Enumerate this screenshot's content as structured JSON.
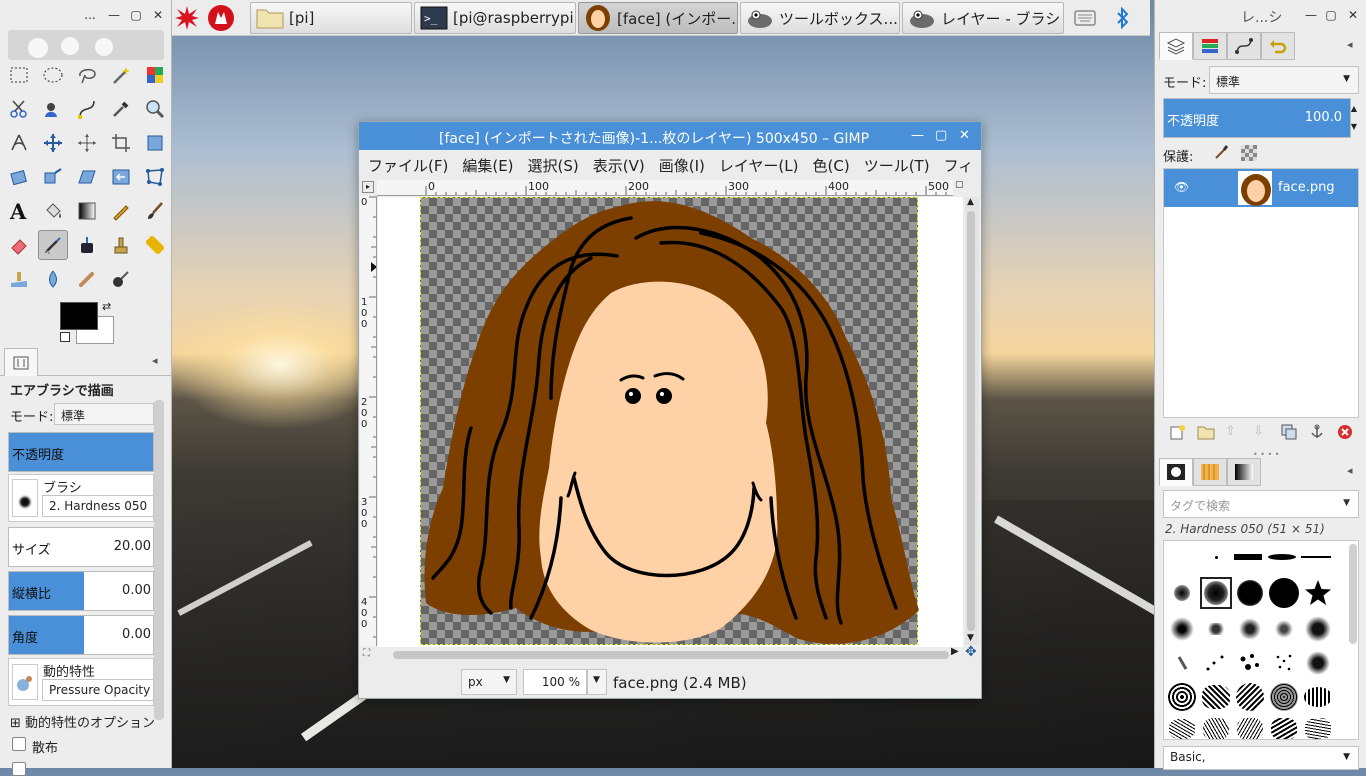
{
  "taskbar": {
    "tasks": [
      {
        "label": "[pi]",
        "icon": "folder-icon"
      },
      {
        "label": "[pi@raspberrypi:...",
        "icon": "terminal-icon"
      },
      {
        "label": "[face] (インポー...",
        "icon": "face-thumbnail-icon"
      },
      {
        "label": "ツールボックス...",
        "icon": "gimp-icon"
      },
      {
        "label": "レイヤー - ブラシ",
        "icon": "gimp-icon"
      }
    ]
  },
  "toolbox": {
    "title_dots": "...",
    "options_title": "エアブラシで描画",
    "mode_label": "モード:",
    "mode_value": "標準",
    "opacity_label": "不透明度",
    "brush_label": "ブラシ",
    "brush_value": "2. Hardness 050",
    "size_label": "サイズ",
    "size_value": "20.00",
    "aspect_label": "縦横比",
    "aspect_value": "0.00",
    "angle_label": "角度",
    "angle_value": "0.00",
    "dynamics_label": "動的特性",
    "dynamics_value": "Pressure Opacity",
    "dynamics_options_label": "動的特性のオプション",
    "jitter_label": "散布"
  },
  "image_window": {
    "title": "[face] (インポートされた画像)-1...枚のレイヤー) 500x450 – GIMP",
    "menu": [
      "ファイル(F)",
      "編集(E)",
      "選択(S)",
      "表示(V)",
      "画像(I)",
      "レイヤー(L)",
      "色(C)",
      "ツール(T)",
      "フィ"
    ],
    "ruler_h": [
      "0",
      "100",
      "200",
      "300",
      "400",
      "500"
    ],
    "ruler_v": [
      "0",
      "100",
      "200",
      "300",
      "400"
    ],
    "unit": "px",
    "zoom": "100 %",
    "status": "face.png (2.4 MB)"
  },
  "right_dock": {
    "title": "レ...シ",
    "mode_label": "モード:",
    "mode_value": "標準",
    "opacity_label": "不透明度",
    "opacity_value": "100.0",
    "lock_label": "保護:",
    "layer_name": "face.png",
    "tag_placeholder": "タグで検索",
    "brush_info": "2. Hardness 050 (51 × 51)",
    "preset_value": "Basic,"
  },
  "colors": {
    "accent": "#4a90d9",
    "hair": "#7c3f00",
    "skin": "#ffd1a6"
  }
}
